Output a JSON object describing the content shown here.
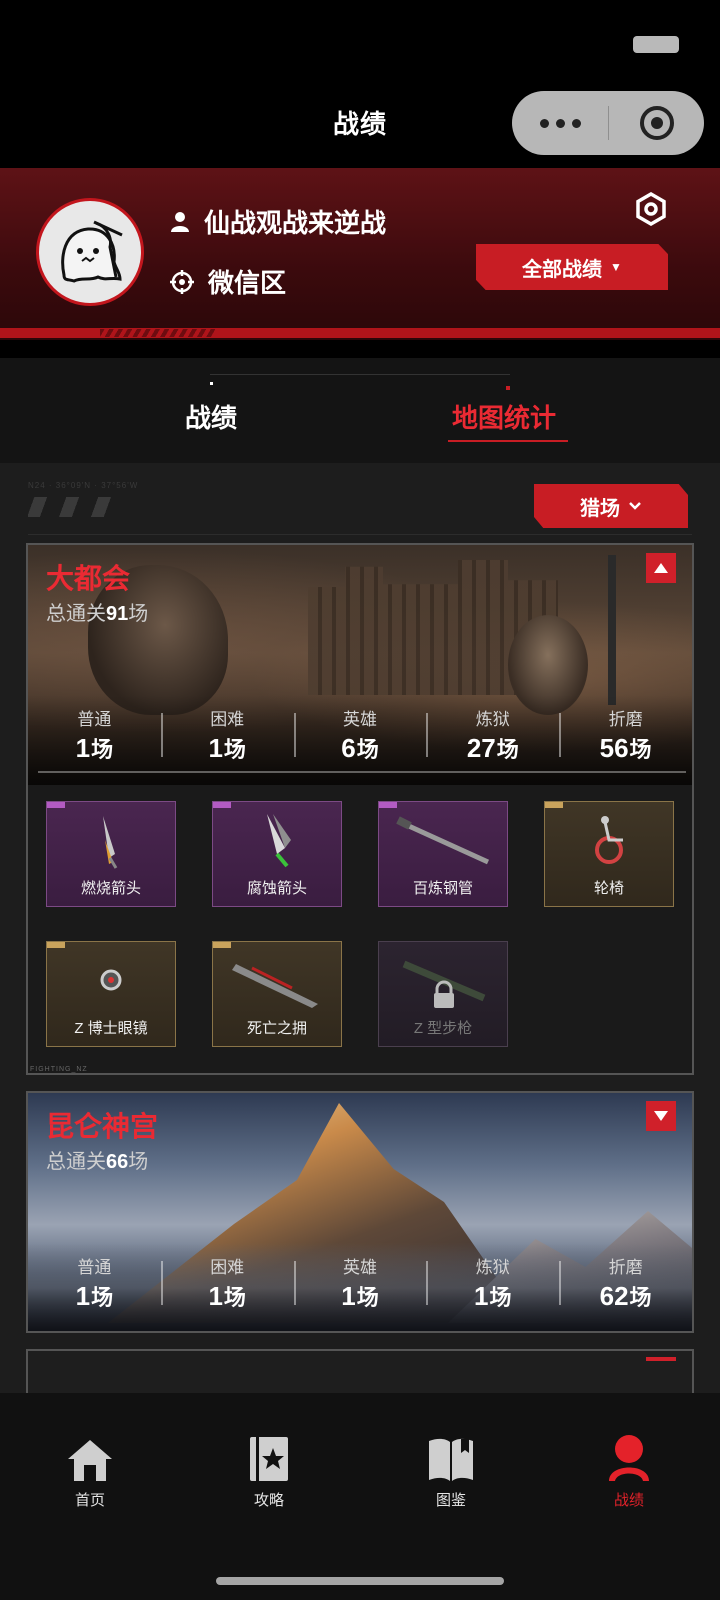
{
  "page": {
    "title": "战绩"
  },
  "profile": {
    "name": "仙战观战来逆战",
    "zone": "微信区",
    "all_records_label": "全部战绩"
  },
  "tabs": [
    {
      "label": "战绩",
      "active": false
    },
    {
      "label": "地图统计",
      "active": true
    }
  ],
  "filter": {
    "mode_label": "猎场"
  },
  "maps": [
    {
      "name": "大都会",
      "total_prefix": "总通关",
      "total_count": "91",
      "total_suffix": "场",
      "expanded": true,
      "difficulties": [
        {
          "name": "普通",
          "count": "1",
          "unit": "场"
        },
        {
          "name": "困难",
          "count": "1",
          "unit": "场"
        },
        {
          "name": "英雄",
          "count": "6",
          "unit": "场"
        },
        {
          "name": "炼狱",
          "count": "27",
          "unit": "场"
        },
        {
          "name": "折磨",
          "count": "56",
          "unit": "场"
        }
      ],
      "items": [
        {
          "name": "燃烧箭头",
          "rarity": "purple",
          "icon": "flaming-arrowhead-icon",
          "locked": false
        },
        {
          "name": "腐蚀箭头",
          "rarity": "purple",
          "icon": "corrosive-arrowhead-icon",
          "locked": false
        },
        {
          "name": "百炼钢管",
          "rarity": "purple",
          "icon": "steel-pipe-icon",
          "locked": false
        },
        {
          "name": "轮椅",
          "rarity": "gold",
          "icon": "wheelchair-icon",
          "locked": false
        },
        {
          "name": "Z 博士眼镜",
          "rarity": "gold",
          "icon": "goggles-icon",
          "locked": false
        },
        {
          "name": "死亡之拥",
          "rarity": "gold",
          "icon": "death-embrace-weapon-icon",
          "locked": false
        },
        {
          "name": "Z 型步枪",
          "rarity": "locked",
          "icon": "z-rifle-icon",
          "locked": true
        }
      ]
    },
    {
      "name": "昆仑神宫",
      "total_prefix": "总通关",
      "total_count": "66",
      "total_suffix": "场",
      "expanded": false,
      "difficulties": [
        {
          "name": "普通",
          "count": "1",
          "unit": "场"
        },
        {
          "name": "困难",
          "count": "1",
          "unit": "场"
        },
        {
          "name": "英雄",
          "count": "1",
          "unit": "场"
        },
        {
          "name": "炼狱",
          "count": "1",
          "unit": "场"
        },
        {
          "name": "折磨",
          "count": "62",
          "unit": "场"
        }
      ]
    }
  ],
  "card_footer_text": "FIGHTING_NZ",
  "tabbar": [
    {
      "label": "首页",
      "icon": "home-icon",
      "active": false
    },
    {
      "label": "攻略",
      "icon": "guide-book-icon",
      "active": false
    },
    {
      "label": "图鉴",
      "icon": "catalog-book-icon",
      "active": false
    },
    {
      "label": "战绩",
      "icon": "profile-icon",
      "active": true
    }
  ],
  "colors": {
    "accent": "#c81d24",
    "accent_text": "#ea2a33",
    "background": "#1d1d1d",
    "gold": "#8a7448",
    "purple": "#7c4a85"
  }
}
